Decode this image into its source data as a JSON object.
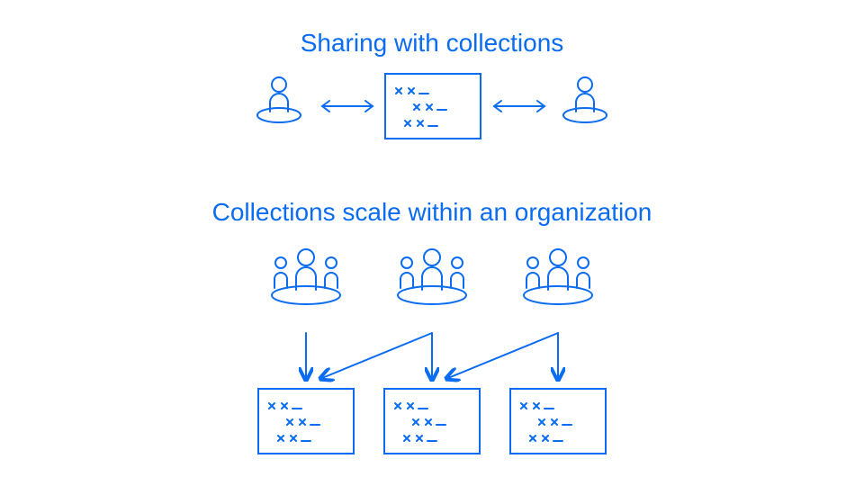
{
  "color": "#0a6cf0",
  "section1": {
    "title": "Sharing with collections"
  },
  "section2": {
    "title": "Collections scale within an organization"
  }
}
